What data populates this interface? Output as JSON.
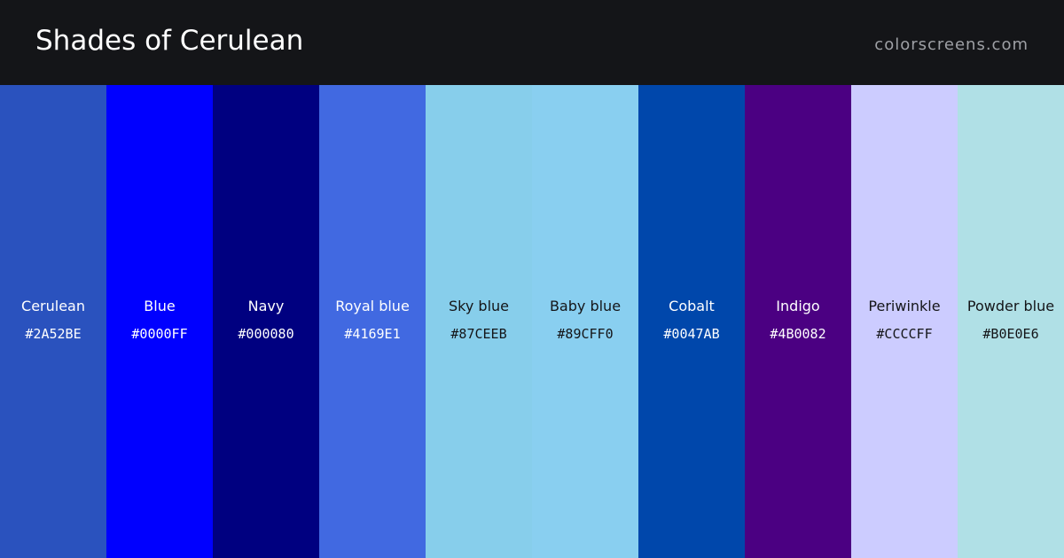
{
  "header": {
    "title": "Shades of Cerulean",
    "site": "colorscreens.com"
  },
  "swatches": [
    {
      "name": "Cerulean",
      "hex": "#2A52BE",
      "text": "light"
    },
    {
      "name": "Blue",
      "hex": "#0000FF",
      "text": "light"
    },
    {
      "name": "Navy",
      "hex": "#000080",
      "text": "light"
    },
    {
      "name": "Royal blue",
      "hex": "#4169E1",
      "text": "light"
    },
    {
      "name": "Sky blue",
      "hex": "#87CEEB",
      "text": "dark"
    },
    {
      "name": "Baby blue",
      "hex": "#89CFF0",
      "text": "dark"
    },
    {
      "name": "Cobalt",
      "hex": "#0047AB",
      "text": "light"
    },
    {
      "name": "Indigo",
      "hex": "#4B0082",
      "text": "light"
    },
    {
      "name": "Periwinkle",
      "hex": "#CCCCFF",
      "text": "dark"
    },
    {
      "name": "Powder blue",
      "hex": "#B0E0E6",
      "text": "dark"
    }
  ]
}
